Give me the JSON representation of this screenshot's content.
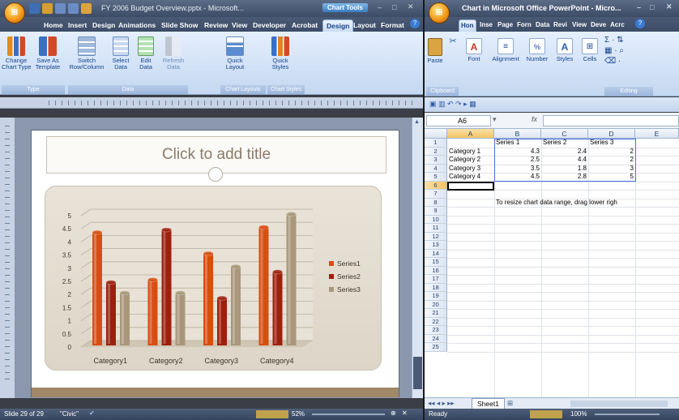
{
  "ppt": {
    "title": "FY 2006 Budget Overview.pptx - Microsoft...",
    "context_tab": "Chart Tools",
    "tabs": [
      "Home",
      "Insert",
      "Design",
      "Animations",
      "Slide Show",
      "Review",
      "View",
      "Developer",
      "Acrobat",
      "Design",
      "Layout",
      "Format"
    ],
    "active_tab": "Design",
    "ribbon": {
      "groups": [
        {
          "label": "Type",
          "buttons": [
            "Change\nChart Type",
            "Save As\nTemplate"
          ]
        },
        {
          "label": "Data",
          "buttons": [
            "Switch\nRow/Column",
            "Select\nData",
            "Edit\nData",
            "Refresh\nData"
          ]
        },
        {
          "label": "Chart Layouts",
          "buttons": [
            "Quick\nLayout"
          ]
        },
        {
          "label": "Chart Styles",
          "buttons": [
            "Quick\nStyles"
          ]
        }
      ]
    },
    "slide_title_placeholder": "Click to add title",
    "status": {
      "slide": "Slide 29 of 29",
      "theme": "\"Civic\"",
      "zoom": "52%"
    }
  },
  "chart_data": {
    "type": "bar",
    "categories": [
      "Category1",
      "Category2",
      "Category3",
      "Category4"
    ],
    "series": [
      {
        "name": "Series1",
        "values": [
          4.3,
          2.5,
          3.5,
          4.5
        ],
        "color": "#d94d10"
      },
      {
        "name": "Series2",
        "values": [
          2.4,
          4.4,
          1.8,
          2.8
        ],
        "color": "#9e1f0e"
      },
      {
        "name": "Series3",
        "values": [
          2.0,
          2.0,
          3.0,
          5.0
        ],
        "color": "#a8977a"
      }
    ],
    "yticks": [
      "0",
      "0.5",
      "1",
      "1.5",
      "2",
      "2.5",
      "3",
      "3.5",
      "4",
      "4.5",
      "5"
    ],
    "ylim": [
      0,
      5
    ],
    "legend": "right",
    "grid": true
  },
  "xl": {
    "title": "Chart in Microsoft Office PowerPoint - Micro...",
    "tabs": [
      "Hon",
      "Inse",
      "Page",
      "Forn",
      "Data",
      "Revi",
      "View",
      "Deve",
      "Acrc"
    ],
    "ribbon_groups": [
      "Paste",
      "Font",
      "Alignment",
      "Number",
      "Styles",
      "Cells",
      "Editing"
    ],
    "clipboard_label": "Clipboard",
    "editing_label": "Editing",
    "name_box": "A6",
    "fx": "fx",
    "columns": [
      "A",
      "B",
      "C",
      "D",
      "E"
    ],
    "rows": [
      "1",
      "2",
      "3",
      "4",
      "5",
      "6",
      "7",
      "8",
      "9",
      "10",
      "11",
      "12",
      "13",
      "14",
      "15",
      "16",
      "17",
      "18",
      "19",
      "20",
      "21",
      "22",
      "23",
      "24",
      "25"
    ],
    "headers": [
      "Series 1",
      "Series 2",
      "Series 3"
    ],
    "data_rows": [
      {
        "label": "Category 1",
        "v": [
          "4.3",
          "2.4",
          "2"
        ]
      },
      {
        "label": "Category 2",
        "v": [
          "2.5",
          "4.4",
          "2"
        ]
      },
      {
        "label": "Category 3",
        "v": [
          "3.5",
          "1.8",
          "3"
        ]
      },
      {
        "label": "Category 4",
        "v": [
          "4.5",
          "2.8",
          "5"
        ]
      }
    ],
    "note": "To resize chart data range, drag lower righ",
    "sheet_tab": "Sheet1",
    "status": {
      "ready": "Ready",
      "zoom": "100%"
    }
  }
}
